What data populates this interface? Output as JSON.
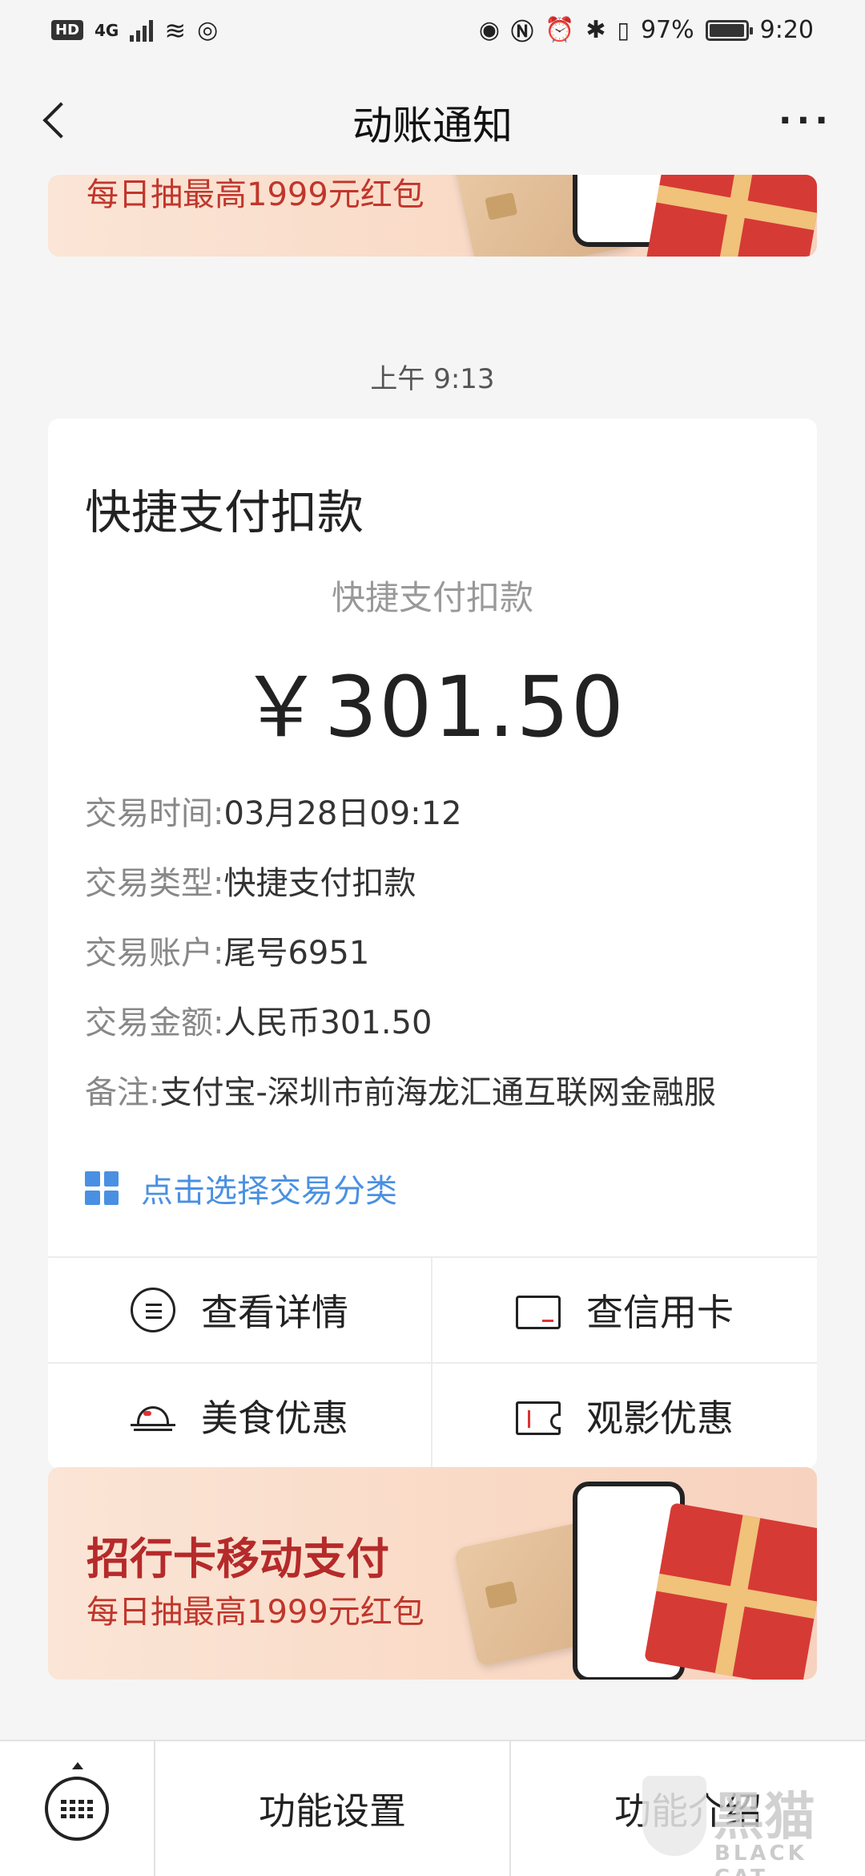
{
  "status_bar": {
    "hd": "HD",
    "network": "4G",
    "battery_percent": "97%",
    "time": "9:20"
  },
  "nav": {
    "title": "动账通知",
    "more": "···"
  },
  "top_banner": {
    "subtitle": "每日抽最高1999元红包"
  },
  "message": {
    "timestamp": "上午 9:13",
    "heading": "快捷支付扣款",
    "subtitle": "快捷支付扣款",
    "amount": "￥301.50",
    "details": [
      {
        "key": "交易时间:",
        "value": "03月28日09:12"
      },
      {
        "key": "交易类型:",
        "value": "快捷支付扣款"
      },
      {
        "key": "交易账户:",
        "value": "尾号6951"
      },
      {
        "key": "交易金额:",
        "value": "人民币301.50"
      },
      {
        "key": "备注:",
        "value": "支付宝-深圳市前海龙汇通互联网金融服"
      }
    ],
    "category_link": "点击选择交易分类",
    "actions": [
      {
        "label": "查看详情",
        "icon": "list-circle-icon"
      },
      {
        "label": "查信用卡",
        "icon": "credit-card-icon"
      },
      {
        "label": "美食优惠",
        "icon": "food-cloche-icon"
      },
      {
        "label": "观影优惠",
        "icon": "movie-ticket-icon"
      }
    ]
  },
  "bottom_banner": {
    "title": "招行卡移动支付",
    "subtitle": "每日抽最高1999元红包"
  },
  "bottom_bar": {
    "items": [
      "功能设置",
      "功能介绍"
    ]
  },
  "watermark": {
    "big": "黑猫",
    "small": "BLACK CAT"
  },
  "colors": {
    "link": "#4a90e2",
    "banner_text": "#c0362c",
    "background": "#f5f5f5"
  }
}
